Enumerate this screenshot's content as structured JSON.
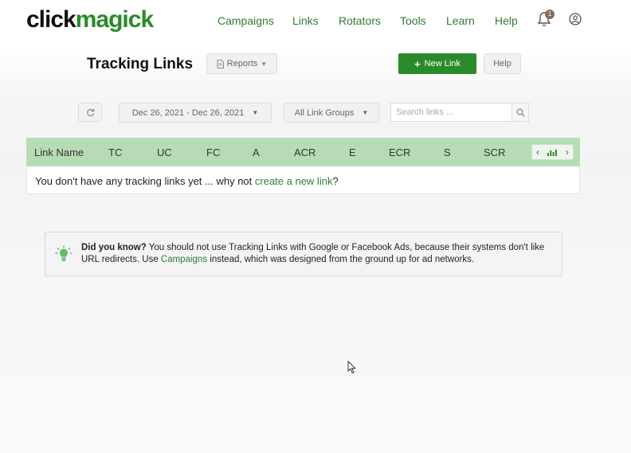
{
  "header": {
    "logo_part1": "click",
    "logo_part2": "magick",
    "nav": [
      "Campaigns",
      "Links",
      "Rotators",
      "Tools",
      "Learn",
      "Help"
    ],
    "notification_count": "1"
  },
  "page": {
    "title": "Tracking Links",
    "reports_label": "Reports",
    "new_link_label": "New Link",
    "help_label": "Help"
  },
  "filters": {
    "date_range": "Dec 26, 2021 - Dec 26, 2021",
    "link_group": "All Link Groups",
    "search_placeholder": "Search links ..."
  },
  "table": {
    "columns": [
      "Link Name",
      "TC",
      "UC",
      "FC",
      "A",
      "ACR",
      "E",
      "ECR",
      "S",
      "SCR"
    ],
    "empty_prefix": "You don't have any tracking links yet ... why not ",
    "empty_link": "create a new link",
    "empty_suffix": "?"
  },
  "tip": {
    "bold": "Did you know?",
    "text1": " You should not use Tracking Links with Google or Facebook Ads, because their systems don't like URL redirects. Use ",
    "link": "Campaigns",
    "text2": " instead, which was designed from the ground up for ad networks."
  },
  "icons": {
    "bell": "bell-icon",
    "user": "user-circle-icon",
    "reports": "document-icon",
    "refresh": "refresh-icon",
    "search": "search-icon",
    "tip": "lightbulb-icon"
  },
  "colors": {
    "brand_green": "#2a8a2a",
    "nav_green": "#2e7d32",
    "table_header": "#b7dcb5"
  }
}
